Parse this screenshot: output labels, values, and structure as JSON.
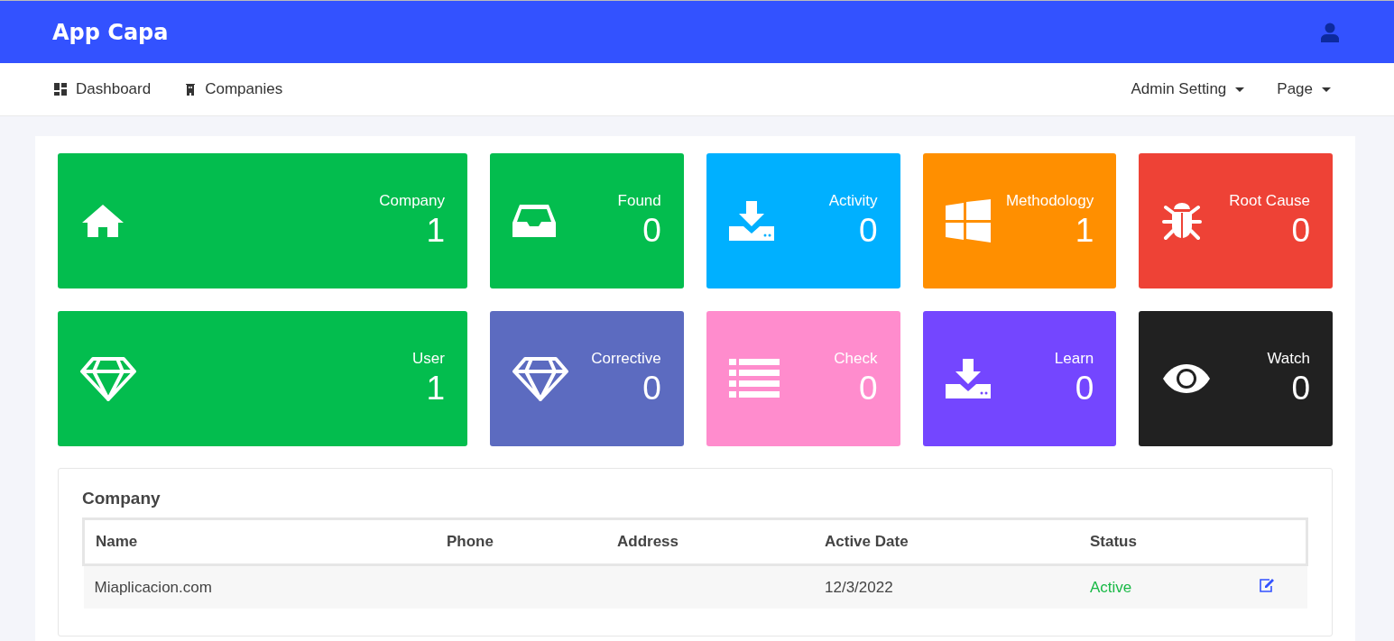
{
  "brand": "App Capa",
  "nav_left": [
    {
      "label": "Dashboard",
      "kind": "grid"
    },
    {
      "label": "Companies",
      "kind": "building"
    }
  ],
  "nav_right": [
    {
      "label": "Admin Setting"
    },
    {
      "label": "Page"
    }
  ],
  "stats": [
    {
      "label": "Company",
      "value": "1",
      "kind": "home",
      "color": "#03bd4e"
    },
    {
      "label": "Found",
      "value": "0",
      "kind": "inbox",
      "color": "#03bd4e"
    },
    {
      "label": "Activity",
      "value": "0",
      "kind": "download",
      "color": "#00b0ff"
    },
    {
      "label": "Methodology",
      "value": "1",
      "kind": "windows",
      "color": "#ff8f00"
    },
    {
      "label": "Root Cause",
      "value": "0",
      "kind": "bug",
      "color": "#ee4236"
    },
    {
      "label": "User",
      "value": "1",
      "kind": "diamond",
      "color": "#03bd4e"
    },
    {
      "label": "Corrective",
      "value": "0",
      "kind": "diamond",
      "color": "#5c6bc0"
    },
    {
      "label": "Check",
      "value": "0",
      "kind": "list",
      "color": "#ff8ccd"
    },
    {
      "label": "Learn",
      "value": "0",
      "kind": "download",
      "color": "#7446ff"
    },
    {
      "label": "Watch",
      "value": "0",
      "kind": "eye",
      "color": "#212121"
    }
  ],
  "table": {
    "title": "Company",
    "columns": [
      "Name",
      "Phone",
      "Address",
      "Active Date",
      "Status"
    ],
    "rows": [
      {
        "name": "Miaplicacion.com",
        "active_date": "12/3/2022",
        "status": "Active",
        "active": true
      }
    ]
  }
}
